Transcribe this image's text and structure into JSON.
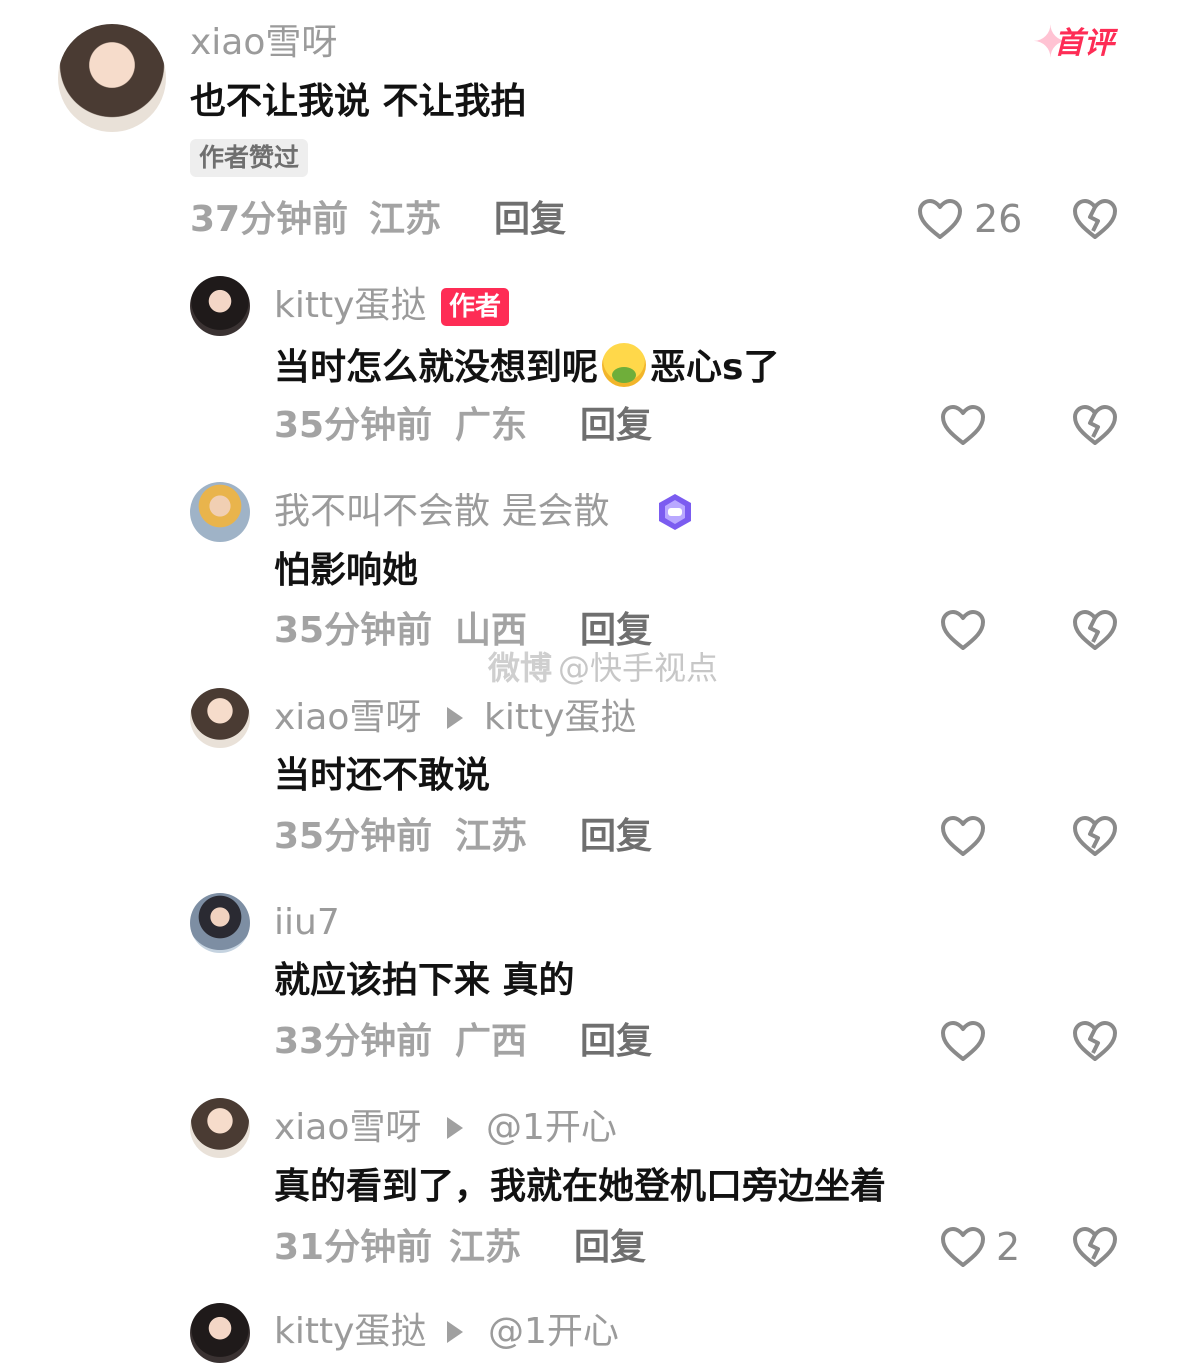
{
  "badge_first": "首评",
  "badge_liked": "作者赞过",
  "badge_author": "作者",
  "watermark": {
    "logo": "微博",
    "text": "@快手视点"
  },
  "reply_label": "回复",
  "comments": [
    {
      "user": "xiao雪呀",
      "text": "也不让我说 不让我拍",
      "time": "37分钟前",
      "location": "江苏",
      "likes": "26"
    },
    {
      "user": "kitty蛋挞",
      "text_before": "当时怎么就没想到呢",
      "emoji": "nauseated-face",
      "text_after": "恶心s了",
      "time": "35分钟前",
      "location": "广东"
    },
    {
      "user": "我不叫不会散 是会散",
      "user_badge": "purple-shield-badge",
      "text": "怕影响她",
      "time": "35分钟前",
      "location": "山西"
    },
    {
      "user": "xiao雪呀",
      "reply_to": "kitty蛋挞",
      "text": "当时还不敢说",
      "time": "35分钟前",
      "location": "江苏"
    },
    {
      "user": "iiu7",
      "text": "就应该拍下来 真的",
      "time": "33分钟前",
      "location": "广西"
    },
    {
      "user": "xiao雪呀",
      "reply_to": "@1开心",
      "text": "真的看到了，我就在她登机口旁边坐着",
      "time": "31分钟前",
      "location": "江苏",
      "likes": "2"
    },
    {
      "user": "kitty蛋挞",
      "reply_to": "@1开心"
    }
  ],
  "colors": {
    "accent": "#fe2c55",
    "meta": "#a3a3a3",
    "username": "#9b9b9b",
    "text": "#121212"
  }
}
